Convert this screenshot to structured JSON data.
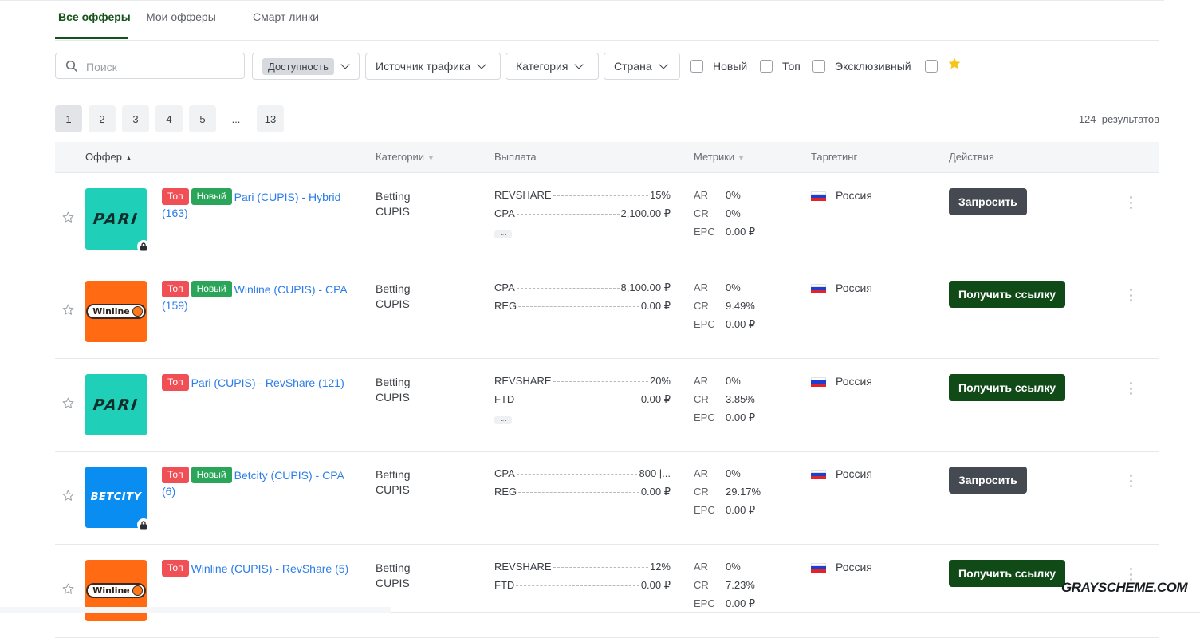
{
  "tabs": [
    {
      "label": "Все офферы"
    },
    {
      "label": "Мои офферы"
    },
    {
      "label": "Смарт линки"
    }
  ],
  "filters": {
    "search_placeholder": "Поиск",
    "availability": "Доступность",
    "traffic_source": "Источник трафика",
    "category": "Категория",
    "country": "Страна",
    "checkboxes": [
      {
        "label": "Новый",
        "checked": false
      },
      {
        "label": "Топ",
        "checked": false
      },
      {
        "label": "Эксклюзивный",
        "checked": false
      },
      {
        "label": "",
        "icon": "star-icon",
        "checked": false
      }
    ]
  },
  "pagination": {
    "pages": [
      "1",
      "2",
      "3",
      "4",
      "5",
      "...",
      "13"
    ],
    "current": "1",
    "results_count": "124",
    "results_label": "результатов"
  },
  "table": {
    "headers": {
      "offer": "Оффер",
      "categories": "Категории",
      "payout": "Выплата",
      "metrics": "Метрики",
      "targeting": "Таргетинг",
      "actions": "Действия"
    },
    "rows": [
      {
        "brand": "pari",
        "locked": true,
        "top": "Топ",
        "new": "Новый",
        "title": "Pari (CUPIS) - Hybrid (163)",
        "categories": [
          "Betting",
          "CUPIS"
        ],
        "payouts": [
          {
            "label": "REVSHARE",
            "value": "15%"
          },
          {
            "label": "CPA",
            "value": "2,100.00 ₽"
          }
        ],
        "more": "...",
        "metrics": {
          "ar": "0%",
          "cr": "0%",
          "epc": "0.00 ₽"
        },
        "country": "Россия",
        "action": "Запросить",
        "action_type": "request"
      },
      {
        "brand": "winline",
        "locked": false,
        "top": "Топ",
        "new": "Новый",
        "title": "Winline (CUPIS) - CPA (159)",
        "categories": [
          "Betting",
          "CUPIS"
        ],
        "payouts": [
          {
            "label": "CPA",
            "value": "8,100.00 ₽"
          },
          {
            "label": "REG",
            "value": "0.00 ₽"
          }
        ],
        "more": "",
        "metrics": {
          "ar": "0%",
          "cr": "9.49%",
          "epc": "0.00 ₽"
        },
        "country": "Россия",
        "action": "Получить ссылку",
        "action_type": "link"
      },
      {
        "brand": "pari",
        "locked": false,
        "top": "Топ",
        "new": "",
        "title": "Pari (CUPIS) - RevShare (121)",
        "categories": [
          "Betting",
          "CUPIS"
        ],
        "payouts": [
          {
            "label": "REVSHARE",
            "value": "20%"
          },
          {
            "label": "FTD",
            "value": "0.00 ₽"
          }
        ],
        "more": "...",
        "metrics": {
          "ar": "0%",
          "cr": "3.85%",
          "epc": "0.00 ₽"
        },
        "country": "Россия",
        "action": "Получить ссылку",
        "action_type": "link"
      },
      {
        "brand": "betcity",
        "locked": true,
        "top": "Топ",
        "new": "Новый",
        "title": "Betcity (CUPIS) - CPA (6)",
        "categories": [
          "Betting",
          "CUPIS"
        ],
        "payouts": [
          {
            "label": "CPA",
            "value": "800 |..."
          },
          {
            "label": "REG",
            "value": "0.00 ₽"
          }
        ],
        "more": "",
        "metrics": {
          "ar": "0%",
          "cr": "29.17%",
          "epc": "0.00 ₽"
        },
        "country": "Россия",
        "action": "Запросить",
        "action_type": "request"
      },
      {
        "brand": "winline",
        "locked": false,
        "top": "Топ",
        "new": "",
        "title": "Winline (CUPIS) - RevShare (5)",
        "categories": [
          "Betting",
          "CUPIS"
        ],
        "payouts": [
          {
            "label": "REVSHARE",
            "value": "12%"
          },
          {
            "label": "FTD",
            "value": "0.00 ₽"
          }
        ],
        "more": "",
        "metrics": {
          "ar": "0%",
          "cr": "7.23%",
          "epc": "0.00 ₽"
        },
        "country": "Россия",
        "action": "Получить ссылку",
        "action_type": "link"
      }
    ],
    "metric_labels": {
      "ar": "AR",
      "cr": "CR",
      "epc": "EPC"
    }
  },
  "brand_logos": {
    "pari": "PARI",
    "winline": "Winline",
    "betcity": "BETCITY"
  },
  "colors": {
    "accent": "#14531b",
    "link": "#2b7de9",
    "top_badge": "#ef4f55",
    "new_badge": "#2aa55a",
    "request_button": "#454a52",
    "link_button": "#0f4a17"
  },
  "watermark": "GRAYSCHEME.COM"
}
